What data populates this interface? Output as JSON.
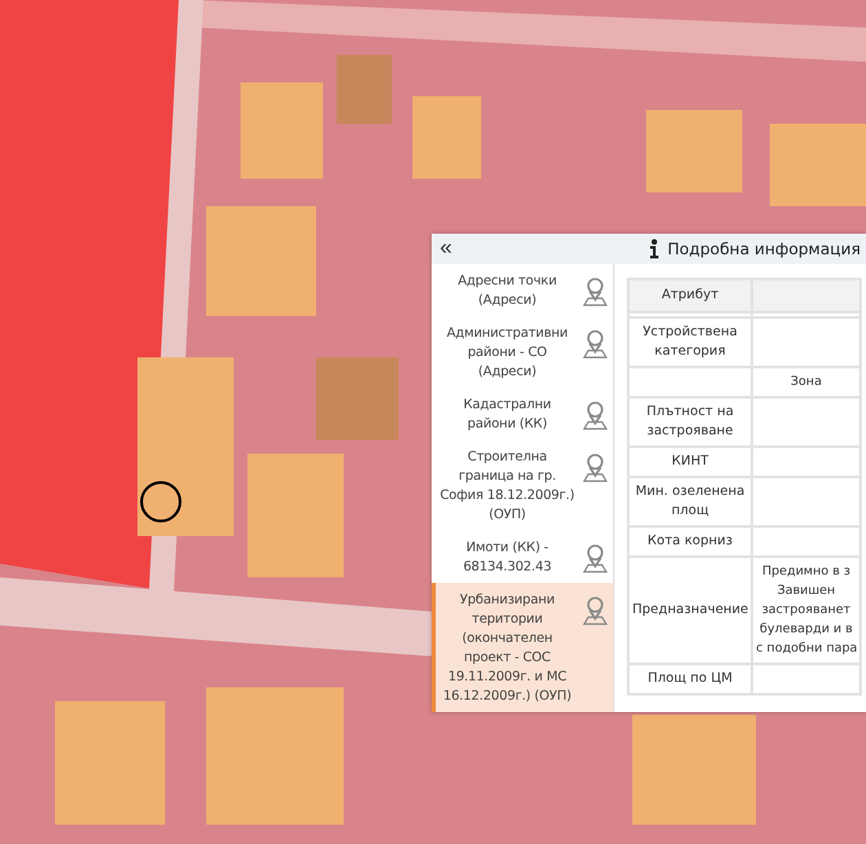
{
  "panel": {
    "collapse": "«",
    "title": "Подробна информация",
    "layers": [
      {
        "label": "Адресни точки (Адреси)",
        "selected": false,
        "disabled": false
      },
      {
        "label": "Административни райони - СО (Адреси)",
        "selected": false,
        "disabled": false
      },
      {
        "label": "Кадастрални райони (КК)",
        "selected": false,
        "disabled": false
      },
      {
        "label": "Строителна граница на гр. София 18.12.2009г.) (ОУП)",
        "selected": false,
        "disabled": false
      },
      {
        "label": "Имоти (КК) - 68134.302.43",
        "selected": false,
        "disabled": false
      },
      {
        "label": "Урбанизирани територии (окончателен проект - СОС 19.11.2009г. и МС 16.12.2009г.) (ОУП)",
        "selected": true,
        "disabled": false
      }
    ],
    "table": {
      "columns": [
        "Атрибут"
      ],
      "rows": [
        {
          "attribute": "",
          "value": []
        },
        {
          "attribute": "Устройствена категория",
          "value": []
        },
        {
          "attribute": "",
          "value": [
            "Зона"
          ]
        },
        {
          "attribute": "Плътност на застрояване",
          "value": []
        },
        {
          "attribute": "КИНТ",
          "value": []
        },
        {
          "attribute": "Мин. озеленена площ",
          "value": []
        },
        {
          "attribute": "Кота корниз",
          "value": []
        },
        {
          "attribute": "Предназначение",
          "value": [
            "Предимно в з",
            "Завишен",
            "застрояванет",
            "булеварди и в",
            "с подобни пара"
          ]
        },
        {
          "attribute": "Площ по ЦМ",
          "value": []
        }
      ]
    }
  }
}
